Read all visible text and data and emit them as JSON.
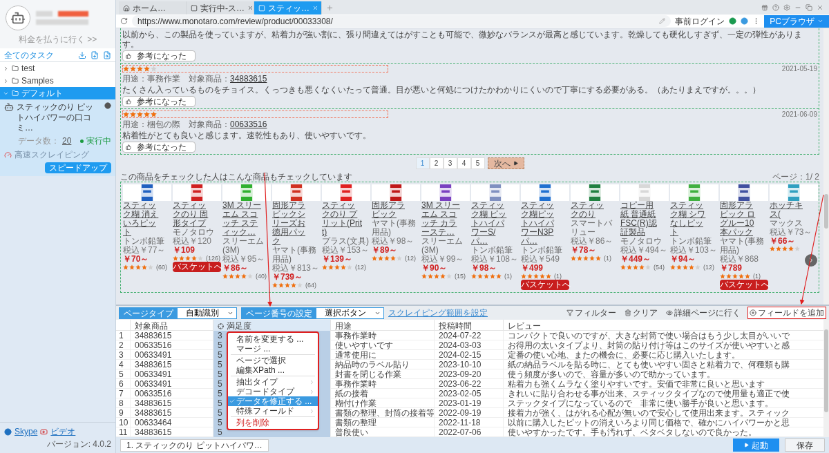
{
  "sidebar": {
    "pay_link": "料金を払うに行く >>",
    "all_tasks": "全てのタスク",
    "tree": [
      {
        "label": "test",
        "expanded": false,
        "selected": false
      },
      {
        "label": "Samples",
        "expanded": false,
        "selected": false
      },
      {
        "label": "デフォルト",
        "expanded": true,
        "selected": true,
        "children": [
          {
            "name": "スティックのり ピットハイパワーの口コミ…",
            "count_label": "データ数：",
            "count": "20",
            "status": "実行中",
            "mode": "高速スクレイピング",
            "speed_button": "スピードアップ"
          }
        ]
      }
    ],
    "footer": {
      "skype": "Skype",
      "video": "ビデオ",
      "version": "バージョン: 4.0.2"
    }
  },
  "browser": {
    "tabs": [
      {
        "label": "ホーム…",
        "kind": "home",
        "selected": false,
        "closable": false
      },
      {
        "label": "実行中-ス…",
        "kind": "page",
        "selected": false,
        "closable": true
      },
      {
        "label": "スティッ…",
        "kind": "page",
        "selected": true,
        "closable": true
      }
    ],
    "url": "https://www.monotaro.com/review/product/00033308/",
    "login": "事前ログイン",
    "mode_button": "PCブラウザ"
  },
  "page": {
    "reviews": [
      {
        "text": "以前から、この製品を使っていますが、粘着力が強い割に、張り間違えてはがすことも可能で、微妙なバランスが最高と感じています。乾燥しても硬化しすぎず、一定の弾性があります。",
        "helpful": "参考になった"
      },
      {
        "stars": 4,
        "date": "2021-05-19",
        "usage": "用途：事務作業",
        "target_label": "対象商品：",
        "target": "34883615",
        "text": "たくさん入っているものをチョイス。くっつきも悪くなくいたって普通。目が悪いと何処につけたかわかりにくいので丁寧にする必要がある。（あたりまえですが。。。）",
        "helpful": "参考になった"
      },
      {
        "stars": 5,
        "date": "2021-06-09",
        "usage": "用途：梱包の際",
        "target_label": "対象商品：",
        "target": "00633516",
        "text": "粘着性がとても良いと感じます。速乾性もあり、使いやすいです。",
        "helpful": "参考になった"
      }
    ],
    "pages": [
      {
        "label": "1",
        "selected": true
      },
      {
        "label": "2",
        "selected": false
      },
      {
        "label": "3",
        "selected": false
      },
      {
        "label": "4",
        "selected": false
      },
      {
        "label": "5",
        "selected": false
      }
    ],
    "next": "次へ",
    "carousel": {
      "title": "この商品をチェックした人はこんな商品もチェックしています",
      "page": "ページ：1/ 2",
      "products": [
        {
          "name": "スティック糊 消えいろピット",
          "maker": "トンボ鉛筆",
          "tax_price": "税込￥77～",
          "price": "￥70～",
          "stars": 4,
          "reviews": "(60)"
        },
        {
          "name": "スティックのり 固形タイプ",
          "maker": "モノタロウ",
          "tax_price": "税込￥120",
          "price": "￥109",
          "stars": 4,
          "reviews": "(126)",
          "basket": "バスケットへ"
        },
        {
          "name": "3M スリーエム スコッチ スティック…",
          "maker": "スリーエム(3M)",
          "tax_price": "税込￥95～",
          "price": "￥86～",
          "stars": 4,
          "reviews": "(40)"
        },
        {
          "name": "固形アラビックシリーズお徳用パック",
          "maker": "ヤマト(事務用品)",
          "tax_price": "税込￥813～",
          "price": "￥739～",
          "stars": 4,
          "reviews": "(64)"
        },
        {
          "name": "スティックのり プリット(Pritt)",
          "maker": "プラス(文具)",
          "tax_price": "税込￥153～",
          "price": "￥139～",
          "stars": 4,
          "reviews": "(12)"
        },
        {
          "name": "固形アラビック",
          "maker": "ヤマト(事務用品)",
          "tax_price": "税込￥98～",
          "price": "￥89～",
          "stars": 4,
          "reviews": "(12)"
        },
        {
          "name": "3M スリーエム スコッチ カラーステ…",
          "maker": "スリーエム(3M)",
          "tax_price": "税込￥99～",
          "price": "￥90～",
          "stars": 4,
          "reviews": "(15)"
        },
        {
          "name": "スティック糊 ピットハイパワーS/パ…",
          "maker": "トンボ鉛筆",
          "tax_price": "税込￥108～",
          "price": "￥98～",
          "stars": 5,
          "reviews": "(1)"
        },
        {
          "name": "スティック糊ピットハイパワーN3Pパ…",
          "maker": "トンボ鉛筆",
          "tax_price": "税込￥549",
          "price": "￥499",
          "stars": 5,
          "reviews": "(1)",
          "basket": "バスケットへ"
        },
        {
          "name": "スティックのり",
          "maker": "スマートバリュー",
          "tax_price": "税込￥86～",
          "price": "￥78～",
          "stars": 5,
          "reviews": "(1)"
        },
        {
          "name": "コピー用紙 普通紙 FSC(R)認証製品",
          "maker": "モノタロウ",
          "tax_price": "税込￥494～",
          "price": "￥449～",
          "stars": 4,
          "reviews": "(54)"
        },
        {
          "name": "スティック糊 シワなしピット",
          "maker": "トンボ鉛筆",
          "tax_price": "税込￥103～",
          "price": "￥94～",
          "stars": 4,
          "reviews": "(12)"
        },
        {
          "name": "固形アラビック ログルー10本パック",
          "maker": "ヤマト(事務用品)",
          "tax_price": "税込￥868",
          "price": "￥789",
          "stars": 5,
          "reviews": "(1)",
          "basket": "バスケットへ"
        },
        {
          "name": "ホッチキス(",
          "maker": "マックス",
          "tax_price": "税込￥73～",
          "price": "￥66～",
          "stars": 4
        }
      ]
    }
  },
  "panel": {
    "page_type_label": "ページタイプ",
    "page_type": "自動識別",
    "page_number_label": "ページ番号の設定",
    "page_number": "選択ボタン",
    "range_link": "スクレイピング範囲を設定",
    "actions": [
      {
        "label": "フィルター",
        "kind": "filter"
      },
      {
        "label": "クリア",
        "kind": "clear"
      },
      {
        "label": "詳細ページに行く",
        "kind": "detail"
      },
      {
        "label": "フィールドを追加",
        "kind": "add"
      }
    ],
    "columns": [
      {
        "label": "対象商品",
        "selected": false
      },
      {
        "label": "満足度",
        "selected": true
      },
      {
        "label": "用途",
        "selected": false
      },
      {
        "label": "投稿時間",
        "selected": false
      },
      {
        "label": "レビュー",
        "selected": false
      }
    ],
    "rows": [
      {
        "no": "1",
        "cells": [
          "34883615",
          "3",
          "事務作業時",
          "2024-07-22",
          "コンパクトで良いのですが、大きな封筒で使い場合はもう少し太目がいいで"
        ]
      },
      {
        "no": "2",
        "cells": [
          "00633516",
          "5",
          "使いやすいです",
          "2024-03-03",
          "お得用の太いタイプより、封筒の貼り付け等はこのサイズが使いやすいと感"
        ]
      },
      {
        "no": "3",
        "cells": [
          "00633491",
          "5",
          "通常使用に",
          "2024-02-15",
          "定番の使い心地、またの機会に、必要に応じ購入いたします。"
        ]
      },
      {
        "no": "4",
        "cells": [
          "34883615",
          "5",
          "納品時のラベル貼り",
          "2023-10-10",
          "紙の納品ラベルを貼る時に、とても使いやすい固さと粘着力で、何種類も購"
        ]
      },
      {
        "no": "5",
        "cells": [
          "00633491",
          "5",
          "封書を閉じる作業",
          "2023-09-20",
          "使う頻度が多いので、容量が多いので助かっています。"
        ]
      },
      {
        "no": "6",
        "cells": [
          "00633491",
          "5",
          "事務作業時",
          "2023-06-22",
          "粘着力も強くムラなく塗りやすいです。安価で非常に良いと思います"
        ]
      },
      {
        "no": "7",
        "cells": [
          "00633516",
          "5",
          "紙の接着",
          "2023-02-05",
          "きれいに貼り合わせる事が出来、スティックタイプなので使用量も適正で使"
        ]
      },
      {
        "no": "8",
        "cells": [
          "34883615",
          "5",
          "糊付け作業",
          "2023-01-19",
          "ステックタイプになっているので　非常に使い勝手が良いと思います。"
        ]
      },
      {
        "no": "9",
        "cells": [
          "34883615",
          "5",
          "書類の整理、封筒の接着等",
          "2022-09-19",
          "接着力が強く、はがれる心配が無いので安心して使用出来ます。スティック"
        ]
      },
      {
        "no": "10",
        "cells": [
          "00633464",
          "5",
          "書類の整理",
          "2022-11-18",
          "以前に購入したピットの消えいろより同じ価格で、確かにハイパワーかと思"
        ]
      },
      {
        "no": "11",
        "cells": [
          "34883615",
          "5",
          "普段使い",
          "2022-07-06",
          "使いやすかったです。手も汚れず、ベタベタしないので良かった。"
        ]
      }
    ],
    "menu": [
      {
        "label": "名前を変更する ...",
        "kind": "item",
        "checked": false
      },
      {
        "label": "マージ ...",
        "kind": "item",
        "checked": false
      },
      {
        "kind": "separator"
      },
      {
        "label": "ページで選択",
        "kind": "item",
        "checked": false
      },
      {
        "label": "編集XPath ...",
        "kind": "item",
        "checked": false
      },
      {
        "kind": "separator"
      },
      {
        "label": "抽出タイプ",
        "kind": "submenu",
        "checked": false
      },
      {
        "label": "デコードタイプ",
        "kind": "submenu",
        "checked": false
      },
      {
        "label": "データを修正する ...",
        "kind": "item",
        "checked": true
      },
      {
        "label": "特殊フィールド",
        "kind": "submenu",
        "checked": false
      },
      {
        "kind": "separator"
      },
      {
        "label": "列を削除",
        "kind": "danger",
        "checked": false
      }
    ],
    "task_tab": "1. スティックのり ピットハイパワ…",
    "start": "起動",
    "save": "保存"
  }
}
